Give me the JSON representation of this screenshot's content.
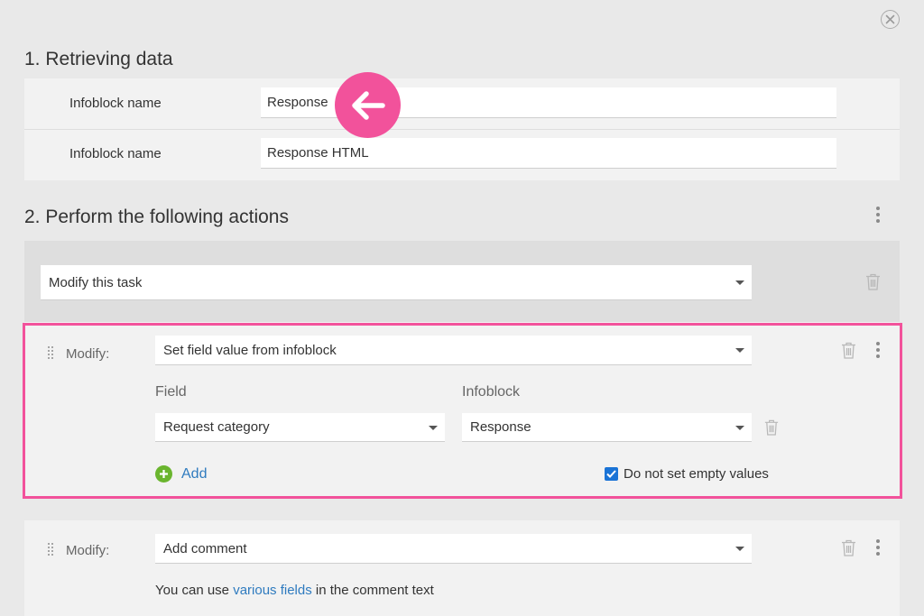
{
  "section1": {
    "title": "1. Retrieving data",
    "rows": [
      {
        "label": "Infoblock name",
        "value": "Response"
      },
      {
        "label": "Infoblock name",
        "value": "Response HTML"
      }
    ]
  },
  "section2": {
    "title": "2. Perform the following actions",
    "action_select": "Modify this task",
    "block1": {
      "modify_label": "Modify:",
      "select": "Set field value from infoblock",
      "field_header": "Field",
      "infoblock_header": "Infoblock",
      "field_value": "Request category",
      "infoblock_value": "Response",
      "add_label": "Add",
      "checkbox_label": "Do not set empty values",
      "checkbox_checked": true
    },
    "block2": {
      "modify_label": "Modify:",
      "select": "Add comment",
      "hint_before": "You can use ",
      "hint_link": "various fields",
      "hint_after": " in the comment text"
    }
  },
  "colors": {
    "highlight": "#f2529b",
    "link": "#2f7bbf",
    "add_icon": "#6ab52e",
    "checkbox": "#1a73d6"
  },
  "icons": [
    "close-icon",
    "arrow-left-icon",
    "kebab-menu-icon",
    "trash-icon",
    "drag-handle-icon",
    "plus-circle-icon",
    "checkmark-icon"
  ]
}
